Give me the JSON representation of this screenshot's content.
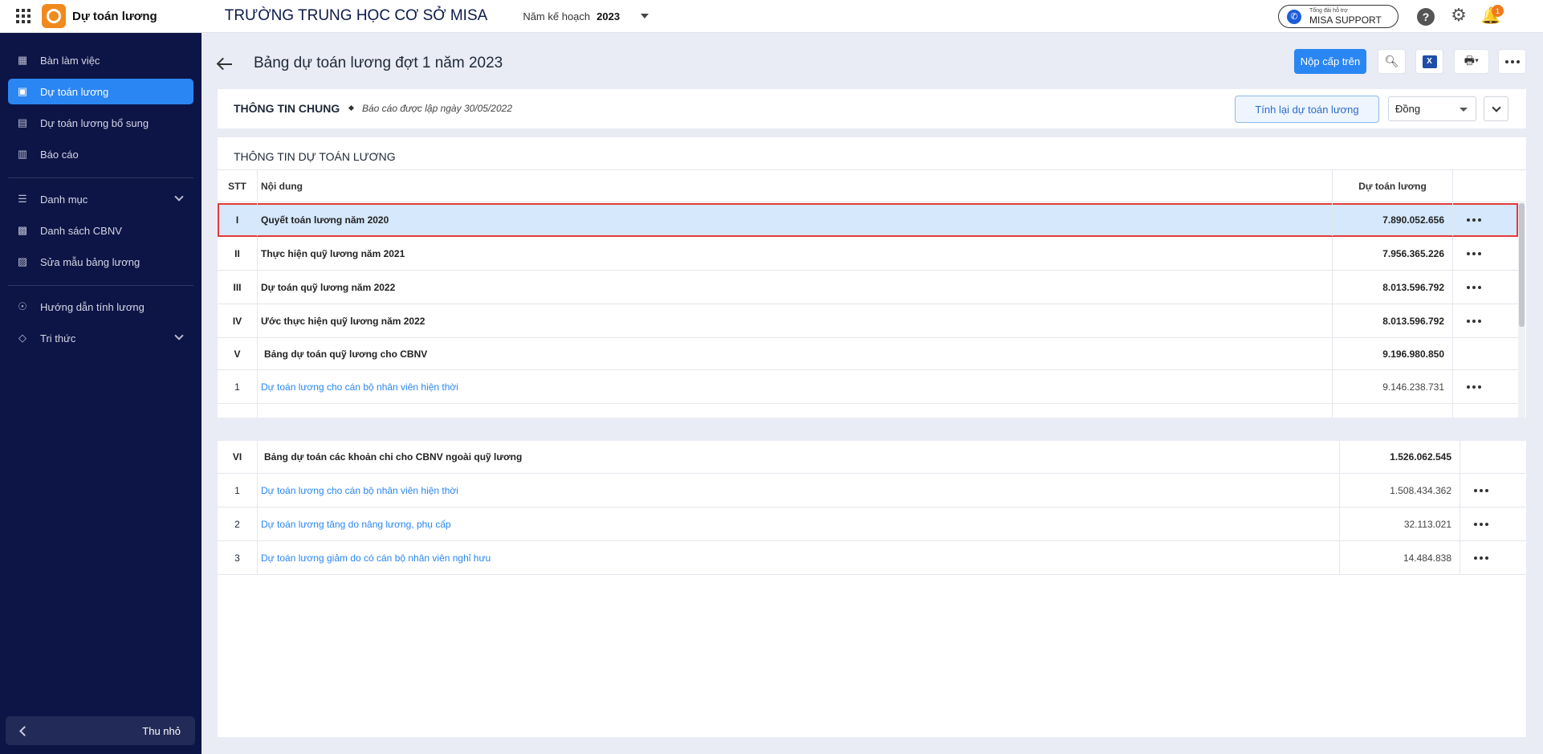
{
  "app": {
    "name": "Dự toán lương",
    "school": "TRƯỜNG TRUNG HỌC CƠ SỞ MISA",
    "year_label": "Năm kế hoạch",
    "year_value": "2023",
    "support_small": "Tổng đài hỗ trợ",
    "support_big": "MISA SUPPORT",
    "notification_count": "1"
  },
  "sidebar": {
    "items": [
      {
        "label": "Bàn làm việc",
        "icon": "dashboard-icon"
      },
      {
        "label": "Dự toán lương",
        "icon": "salary-estimate-icon",
        "active": true
      },
      {
        "label": "Dự toán lương bổ sung",
        "icon": "supplement-icon"
      },
      {
        "label": "Báo cáo",
        "icon": "report-icon"
      },
      {
        "label": "Danh mục",
        "icon": "list-icon"
      },
      {
        "label": "Danh sách CBNV",
        "icon": "staff-icon"
      },
      {
        "label": "Sửa mẫu bảng lương",
        "icon": "edit-template-icon"
      },
      {
        "label": "Hướng dẫn tính lương",
        "icon": "guide-icon"
      },
      {
        "label": "Tri thức",
        "icon": "knowledge-icon"
      }
    ],
    "collapse_label": "Thu nhỏ"
  },
  "header": {
    "title": "Bảng dự toán lương đợt 1 năm 2023",
    "submit_label": "Nộp cấp trên"
  },
  "general": {
    "title": "THÔNG TIN CHUNG",
    "date": "Báo cáo được lập ngày 30/05/2022",
    "recalc_label": "Tính lại dự toán lương",
    "unit": "Đồng"
  },
  "table": {
    "title": "THÔNG TIN DỰ TOÁN LƯƠNG",
    "columns": {
      "stt": "STT",
      "content": "Nội dung",
      "value": "Dự toán lương"
    },
    "rows": [
      {
        "stt": "I",
        "content": "Quyết toán lương năm 2020",
        "value": "7.890.052.656"
      },
      {
        "stt": "II",
        "content": "Thực hiện quỹ lương năm 2021",
        "value": "7.956.365.226"
      },
      {
        "stt": "III",
        "content": "Dự toán quỹ lương năm 2022",
        "value": "8.013.596.792"
      },
      {
        "stt": "IV",
        "content": "Ước thực hiện quỹ lương năm 2022",
        "value": "8.013.596.792"
      },
      {
        "stt": "V",
        "content": "Bảng dự toán quỹ lương cho CBNV",
        "value": "9.196.980.850"
      },
      {
        "stt": "1",
        "content": "Dự toán lương cho cán bộ nhân viên hiện thời",
        "value": "9.146.238.731"
      }
    ]
  },
  "lower": {
    "rows": [
      {
        "stt": "VI",
        "content": "Bảng dự toán các khoản chi cho CBNV ngoài quỹ lương",
        "value": "1.526.062.545"
      },
      {
        "stt": "1",
        "content": "Dự toán lương cho cán bộ nhân viên hiện thời",
        "value": "1.508.434.362"
      },
      {
        "stt": "2",
        "content": "Dự toán lương tăng do nâng lương, phụ cấp",
        "value": "32.113.021"
      },
      {
        "stt": "3",
        "content": "Dự toán lương giảm do có cán bộ nhân viên nghỉ hưu",
        "value": "14.484.838"
      }
    ]
  },
  "colors": {
    "accent": "#2a86f2",
    "sidebar": "#0d1446",
    "highlight": "#e23b3b"
  }
}
